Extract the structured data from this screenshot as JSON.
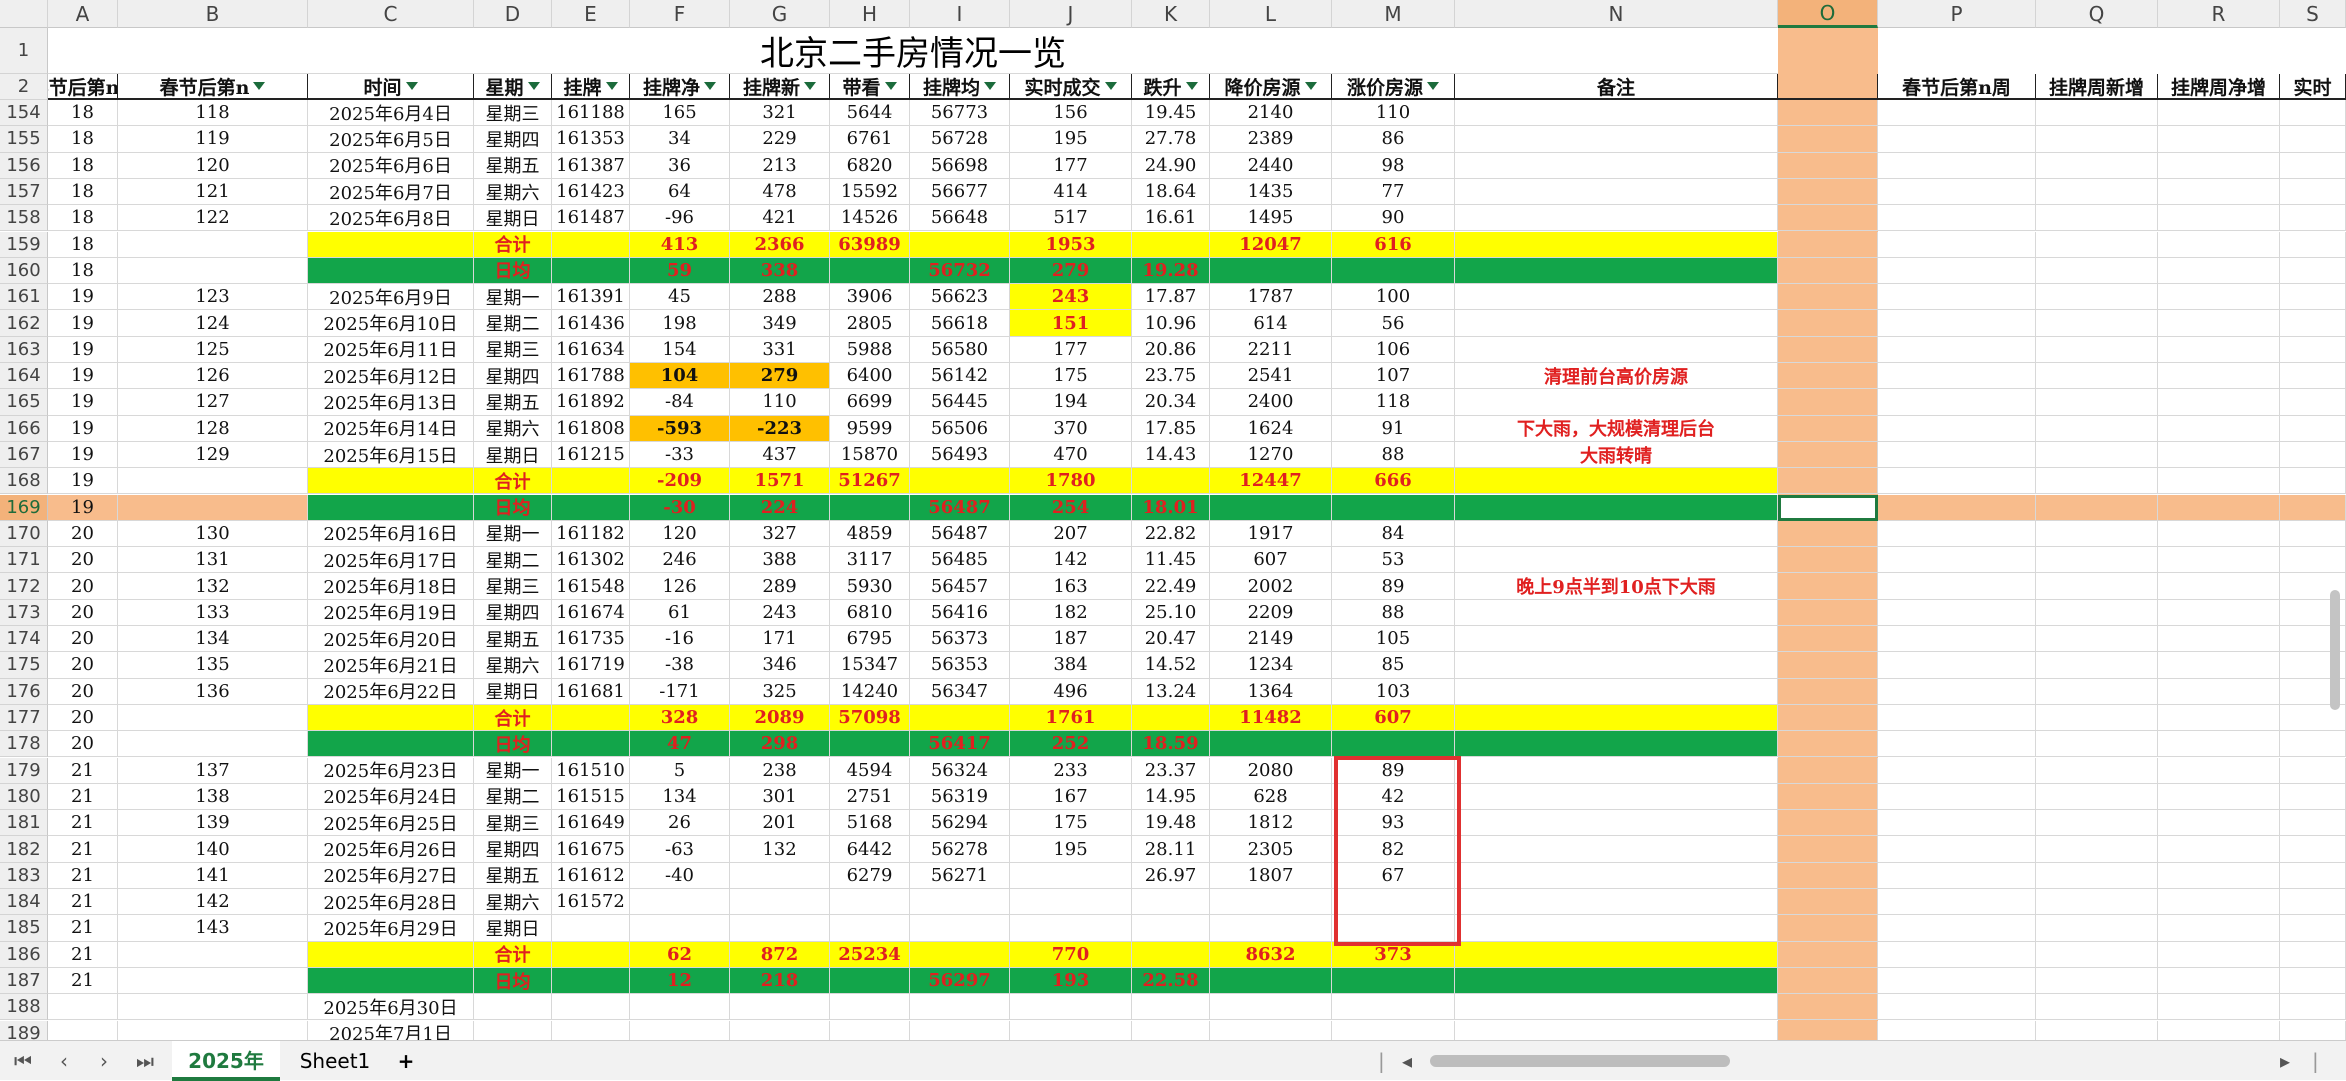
{
  "sheet_title": "北京二手房情况一览",
  "column_letters": [
    "A",
    "B",
    "C",
    "D",
    "E",
    "F",
    "G",
    "H",
    "I",
    "J",
    "K",
    "L",
    "M",
    "N",
    "O",
    "P",
    "Q",
    "R",
    "S"
  ],
  "selected_column": "O",
  "selected_row": "169",
  "header_row_number": "2",
  "title_row_number": "1",
  "headers": [
    "春节后第n",
    "春节后第n",
    "时间",
    "星期",
    "挂牌",
    "挂牌净",
    "挂牌新",
    "带看",
    "挂牌均",
    "实时成交",
    "跌升",
    "降价房源",
    "涨价房源",
    "备注",
    "",
    "春节后第n周",
    "挂牌周新增",
    "挂牌周净增",
    "实时"
  ],
  "header_filter": [
    true,
    true,
    true,
    true,
    true,
    true,
    true,
    true,
    true,
    true,
    true,
    true,
    true,
    false,
    false,
    false,
    false,
    false,
    false
  ],
  "rows": [
    {
      "n": "154",
      "t": "d",
      "c": [
        "18",
        "118",
        "2025年6月4日",
        "星期三",
        "161188",
        "165",
        "321",
        "5644",
        "56773",
        "156",
        "19.45",
        "2140",
        "110",
        ""
      ]
    },
    {
      "n": "155",
      "t": "d",
      "c": [
        "18",
        "119",
        "2025年6月5日",
        "星期四",
        "161353",
        "34",
        "229",
        "6761",
        "56728",
        "195",
        "27.78",
        "2389",
        "86",
        ""
      ]
    },
    {
      "n": "156",
      "t": "d",
      "c": [
        "18",
        "120",
        "2025年6月6日",
        "星期五",
        "161387",
        "36",
        "213",
        "6820",
        "56698",
        "177",
        "24.90",
        "2440",
        "98",
        ""
      ]
    },
    {
      "n": "157",
      "t": "d",
      "c": [
        "18",
        "121",
        "2025年6月7日",
        "星期六",
        "161423",
        "64",
        "478",
        "15592",
        "56677",
        "414",
        "18.64",
        "1435",
        "77",
        ""
      ]
    },
    {
      "n": "158",
      "t": "d",
      "c": [
        "18",
        "122",
        "2025年6月8日",
        "星期日",
        "161487",
        "-96",
        "421",
        "14526",
        "56648",
        "517",
        "16.61",
        "1495",
        "90",
        ""
      ]
    },
    {
      "n": "159",
      "t": "sum",
      "c": [
        "18",
        "",
        "",
        "合计",
        "",
        "413",
        "2366",
        "63989",
        "",
        "1953",
        "",
        "12047",
        "616",
        ""
      ]
    },
    {
      "n": "160",
      "t": "avg",
      "c": [
        "18",
        "",
        "",
        "日均",
        "",
        "59",
        "338",
        "",
        "56732",
        "279",
        "19.28",
        "",
        "",
        ""
      ]
    },
    {
      "n": "161",
      "t": "d",
      "c": [
        "19",
        "123",
        "2025年6月9日",
        "星期一",
        "161391",
        "45",
        "288",
        "3906",
        "56623",
        "243",
        "17.87",
        "1787",
        "100",
        ""
      ],
      "hl": [
        9
      ]
    },
    {
      "n": "162",
      "t": "d",
      "c": [
        "19",
        "124",
        "2025年6月10日",
        "星期二",
        "161436",
        "198",
        "349",
        "2805",
        "56618",
        "151",
        "10.96",
        "614",
        "56",
        ""
      ],
      "hl": [
        9
      ]
    },
    {
      "n": "163",
      "t": "d",
      "c": [
        "19",
        "125",
        "2025年6月11日",
        "星期三",
        "161634",
        "154",
        "331",
        "5988",
        "56580",
        "177",
        "20.86",
        "2211",
        "106",
        ""
      ]
    },
    {
      "n": "164",
      "t": "d",
      "c": [
        "19",
        "126",
        "2025年6月12日",
        "星期四",
        "161788",
        "104",
        "279",
        "6400",
        "56142",
        "175",
        "23.75",
        "2541",
        "107",
        "清理前台高价房源"
      ],
      "hl": [
        5,
        6
      ]
    },
    {
      "n": "165",
      "t": "d",
      "c": [
        "19",
        "127",
        "2025年6月13日",
        "星期五",
        "161892",
        "-84",
        "110",
        "6699",
        "56445",
        "194",
        "20.34",
        "2400",
        "118",
        ""
      ]
    },
    {
      "n": "166",
      "t": "d",
      "c": [
        "19",
        "128",
        "2025年6月14日",
        "星期六",
        "161808",
        "-593",
        "-223",
        "9599",
        "56506",
        "370",
        "17.85",
        "1624",
        "91",
        "下大雨，大规模清理后台"
      ],
      "hl": [
        5,
        6
      ]
    },
    {
      "n": "167",
      "t": "d",
      "c": [
        "19",
        "129",
        "2025年6月15日",
        "星期日",
        "161215",
        "-33",
        "437",
        "15870",
        "56493",
        "470",
        "14.43",
        "1270",
        "88",
        "大雨转晴"
      ]
    },
    {
      "n": "168",
      "t": "sum",
      "c": [
        "19",
        "",
        "",
        "合计",
        "",
        "-209",
        "1571",
        "51267",
        "",
        "1780",
        "",
        "12447",
        "666",
        ""
      ]
    },
    {
      "n": "169",
      "t": "avg",
      "c": [
        "19",
        "",
        "",
        "日均",
        "",
        "-30",
        "224",
        "",
        "56487",
        "254",
        "18.01",
        "",
        "",
        ""
      ]
    },
    {
      "n": "170",
      "t": "d",
      "c": [
        "20",
        "130",
        "2025年6月16日",
        "星期一",
        "161182",
        "120",
        "327",
        "4859",
        "56487",
        "207",
        "22.82",
        "1917",
        "84",
        ""
      ]
    },
    {
      "n": "171",
      "t": "d",
      "c": [
        "20",
        "131",
        "2025年6月17日",
        "星期二",
        "161302",
        "246",
        "388",
        "3117",
        "56485",
        "142",
        "11.45",
        "607",
        "53",
        ""
      ]
    },
    {
      "n": "172",
      "t": "d",
      "c": [
        "20",
        "132",
        "2025年6月18日",
        "星期三",
        "161548",
        "126",
        "289",
        "5930",
        "56457",
        "163",
        "22.49",
        "2002",
        "89",
        "晚上9点半到10点下大雨"
      ]
    },
    {
      "n": "173",
      "t": "d",
      "c": [
        "20",
        "133",
        "2025年6月19日",
        "星期四",
        "161674",
        "61",
        "243",
        "6810",
        "56416",
        "182",
        "25.10",
        "2209",
        "88",
        ""
      ]
    },
    {
      "n": "174",
      "t": "d",
      "c": [
        "20",
        "134",
        "2025年6月20日",
        "星期五",
        "161735",
        "-16",
        "171",
        "6795",
        "56373",
        "187",
        "20.47",
        "2149",
        "105",
        ""
      ]
    },
    {
      "n": "175",
      "t": "d",
      "c": [
        "20",
        "135",
        "2025年6月21日",
        "星期六",
        "161719",
        "-38",
        "346",
        "15347",
        "56353",
        "384",
        "14.52",
        "1234",
        "85",
        ""
      ]
    },
    {
      "n": "176",
      "t": "d",
      "c": [
        "20",
        "136",
        "2025年6月22日",
        "星期日",
        "161681",
        "-171",
        "325",
        "14240",
        "56347",
        "496",
        "13.24",
        "1364",
        "103",
        ""
      ]
    },
    {
      "n": "177",
      "t": "sum",
      "c": [
        "20",
        "",
        "",
        "合计",
        "",
        "328",
        "2089",
        "57098",
        "",
        "1761",
        "",
        "11482",
        "607",
        ""
      ]
    },
    {
      "n": "178",
      "t": "avg",
      "c": [
        "20",
        "",
        "",
        "日均",
        "",
        "47",
        "298",
        "",
        "56417",
        "252",
        "18.59",
        "",
        "",
        ""
      ]
    },
    {
      "n": "179",
      "t": "d",
      "c": [
        "21",
        "137",
        "2025年6月23日",
        "星期一",
        "161510",
        "5",
        "238",
        "4594",
        "56324",
        "233",
        "23.37",
        "2080",
        "89",
        ""
      ]
    },
    {
      "n": "180",
      "t": "d",
      "c": [
        "21",
        "138",
        "2025年6月24日",
        "星期二",
        "161515",
        "134",
        "301",
        "2751",
        "56319",
        "167",
        "14.95",
        "628",
        "42",
        ""
      ]
    },
    {
      "n": "181",
      "t": "d",
      "c": [
        "21",
        "139",
        "2025年6月25日",
        "星期三",
        "161649",
        "26",
        "201",
        "5168",
        "56294",
        "175",
        "19.48",
        "1812",
        "93",
        ""
      ]
    },
    {
      "n": "182",
      "t": "d",
      "c": [
        "21",
        "140",
        "2025年6月26日",
        "星期四",
        "161675",
        "-63",
        "132",
        "6442",
        "56278",
        "195",
        "28.11",
        "2305",
        "82",
        ""
      ]
    },
    {
      "n": "183",
      "t": "d",
      "c": [
        "21",
        "141",
        "2025年6月27日",
        "星期五",
        "161612",
        "-40",
        "",
        "6279",
        "56271",
        "",
        "26.97",
        "1807",
        "67",
        ""
      ]
    },
    {
      "n": "184",
      "t": "d",
      "c": [
        "21",
        "142",
        "2025年6月28日",
        "星期六",
        "161572",
        "",
        "",
        "",
        "",
        "",
        "",
        "",
        "",
        ""
      ]
    },
    {
      "n": "185",
      "t": "d",
      "c": [
        "21",
        "143",
        "2025年6月29日",
        "星期日",
        "",
        "",
        "",
        "",
        "",
        "",
        "",
        "",
        "",
        ""
      ]
    },
    {
      "n": "186",
      "t": "sum",
      "c": [
        "21",
        "",
        "",
        "合计",
        "",
        "62",
        "872",
        "25234",
        "",
        "770",
        "",
        "8632",
        "373",
        ""
      ]
    },
    {
      "n": "187",
      "t": "avg",
      "c": [
        "21",
        "",
        "",
        "日均",
        "",
        "12",
        "218",
        "",
        "56297",
        "193",
        "22.58",
        "",
        "",
        ""
      ]
    },
    {
      "n": "188",
      "t": "d",
      "c": [
        "",
        "",
        "2025年6月30日",
        "",
        "",
        "",
        "",
        "",
        "",
        "",
        "",
        "",
        "",
        ""
      ]
    },
    {
      "n": "189",
      "t": "d",
      "c": [
        "",
        "",
        "2025年7月1日",
        "",
        "",
        "",
        "",
        "",
        "",
        "",
        "",
        "",
        "",
        ""
      ]
    }
  ],
  "tabs": {
    "active": "2025年",
    "other": "Sheet1",
    "add": "+"
  },
  "colors": {
    "yellow": "#ffff00",
    "green": "#12a54a",
    "orange": "#ffc000",
    "selection": "#f8bc8c",
    "red_text": "#e02020"
  }
}
